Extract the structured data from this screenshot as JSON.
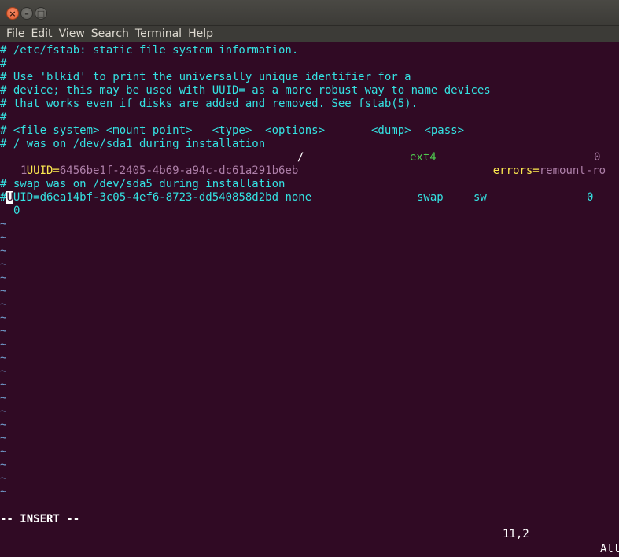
{
  "window": {
    "close_glyph": "×",
    "min_glyph": "–",
    "max_glyph": "□"
  },
  "menu": [
    "File",
    "Edit",
    "View",
    "Search",
    "Terminal",
    "Help"
  ],
  "editor": {
    "l1": "# /etc/fstab: static file system information.",
    "l2": "#",
    "l3": "# Use 'blkid' to print the universally unique identifier for a",
    "l4": "# device; this may be used with UUID= as a more robust way to name devices",
    "l5": "# that works even if disks are added and removed. See fstab(5).",
    "l6": "#",
    "l7": "# <file system> <mount point>   <type>  <options>       <dump>  <pass>",
    "l8": "# / was on /dev/sda1 during installation",
    "l9_key": "UUID=",
    "l9_uuid": "6456be1f-2405-4b69-a94c-dc61a291b6eb",
    "l9_mount": "/",
    "l9_type": "ext4",
    "l9_opt_key": "errors",
    "l9_opt_eq": "=",
    "l9_opt_val": "remount-ro",
    "l9_dump": "0",
    "l9_pass": "1",
    "l10": "# swap was on /dev/sda5 during installation",
    "l11_hash": "#",
    "l11_cursor": "U",
    "l11_rest": "UID=d6ea14bf-3c05-4ef6-8723-dd540858d2bd none",
    "l11_type": "swap",
    "l11_opt": "sw",
    "l11_dump": "0",
    "l11_pass": "0",
    "tilde": "~"
  },
  "status": {
    "mode": "-- INSERT --",
    "position": "11,2",
    "scroll": "All"
  }
}
